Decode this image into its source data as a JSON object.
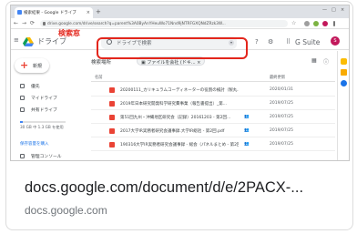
{
  "browser": {
    "tab_title": "検索結果 - Google ドライブ",
    "tab_close": "×",
    "new_tab": "+",
    "window_controls": [
      "—",
      "□",
      "×"
    ],
    "nav_icons": [
      "←",
      "→",
      "⟳"
    ],
    "url": "drive.google.com/drive/search?q=parent%3A0ByAnYHeuWo71Nnd9jNTRFGXQNdZRzk3W...",
    "star": "☆"
  },
  "drive_header": {
    "menu": "≡",
    "product_name": "ドライブ",
    "search_placeholder": "ドライブで検索",
    "search_dropdown": "▾",
    "highlight_label": "検索窓",
    "help": "?",
    "settings": "⚙",
    "apps": "⠿",
    "gsuite": "G Suite",
    "avatar": "S"
  },
  "sidebar": {
    "new_label": "新規",
    "new_icon": "+",
    "items": [
      {
        "label": "優先"
      },
      {
        "label": "マイドライブ"
      },
      {
        "label": "共有ドライブ"
      }
    ],
    "storage_text": "30 GB 中 1.3 GB を使用",
    "storage_fraction": 0.05,
    "buy_label": "保存容量を購入",
    "admin_label": "管理コンソール"
  },
  "main": {
    "crumb": "検索場所",
    "chip": "▣ ファイルを会社 (ドキ... ×",
    "view_icons": [
      "▦",
      "ⓘ"
    ],
    "col_name": "名前",
    "col_date": "最終更新",
    "rows": [
      {
        "name": "20200111_カリキュラムコーディネーターの役割の検討（製丸...",
        "share": "",
        "date": "2020/01/31"
      },
      {
        "name": "2019年日本研究開発科学研究費事業（報告書提出）_第...",
        "share": "",
        "date": "2019/07/25"
      },
      {
        "name": "第51回九州・沖縄地区研究会（記録）20161203 - 第2回...",
        "share": "👥",
        "date": "2019/07/25"
      },
      {
        "name": "2017大学IR実務者研究会議事録.大学IR総括 - 第2回.pdf",
        "share": "👥",
        "date": "2019/07/25"
      },
      {
        "name": "190316大学IR実務者研究会議事録 - 総会（パネルまとめ - 第2回...",
        "share": "👥",
        "date": "2019/07/25"
      }
    ]
  },
  "caption": {
    "title": "docs.google.com/document/d/e/2PACX-...",
    "domain": "docs.google.com"
  },
  "colors": {
    "highlight": "#e3261c",
    "pdf": "#ea4335",
    "accent": "#1a73e8"
  }
}
